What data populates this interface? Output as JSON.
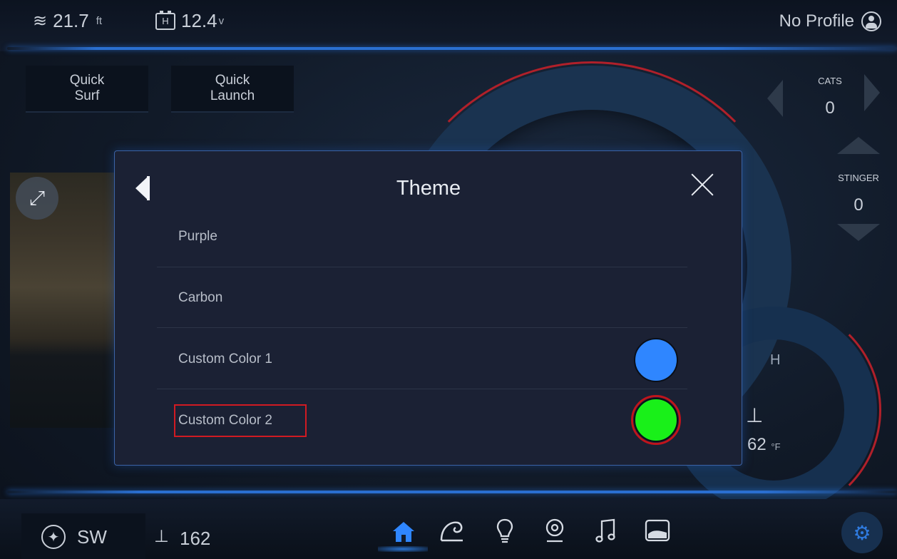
{
  "topbar": {
    "depth_value": "21.7",
    "depth_unit": "ft",
    "depth_icon": "depth-waves-icon",
    "battery_value": "12.4",
    "battery_unit": "v",
    "battery_icon_letter": "H",
    "profile_label": "No Profile",
    "profile_icon": "user-circle-icon"
  },
  "quick_buttons": [
    {
      "label": "Quick\nSurf"
    },
    {
      "label": "Quick\nLaunch"
    }
  ],
  "side_panel": {
    "cats_label": "CATS",
    "cats_value": "0",
    "stinger_label": "STINGER",
    "stinger_value": "0"
  },
  "gauge": {
    "h_label": "H",
    "water_temp_value": "62",
    "water_temp_unit": "°F"
  },
  "dialog": {
    "title": "Theme",
    "items": [
      {
        "label": "Purple"
      },
      {
        "label": "Carbon"
      },
      {
        "label": "Custom Color 1",
        "swatch_color": "#2f86ff"
      },
      {
        "label": "Custom Color 2",
        "swatch_color": "#19f019",
        "selected": true
      }
    ]
  },
  "bottombar": {
    "heading": "SW",
    "depth": "162",
    "nav_icons": [
      "home-icon",
      "wave-icon",
      "lightbulb-icon",
      "location-pin-icon",
      "music-note-icon",
      "boat-hull-icon"
    ],
    "active_nav": "home-icon",
    "settings_icon": "gear-icon"
  },
  "colors": {
    "accent": "#2a6fd0",
    "selection_outline": "#d11a22",
    "dialog_background": "#1b2134"
  }
}
